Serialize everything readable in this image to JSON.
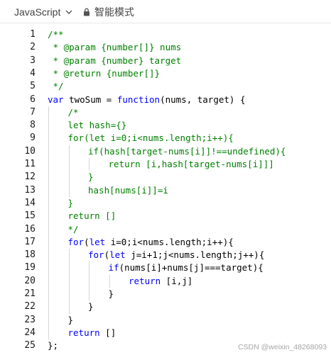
{
  "toolbar": {
    "language": "JavaScript",
    "language_icon": "chevron-down-icon",
    "mode_label": "智能模式",
    "mode_icon": "lock-icon"
  },
  "editor": {
    "lines": [
      {
        "n": "1",
        "indent": 0,
        "tokens": [
          {
            "t": "/**",
            "c": "comment"
          }
        ]
      },
      {
        "n": "2",
        "indent": 0,
        "tokens": [
          {
            "t": " * @param {number[]} nums",
            "c": "comment"
          }
        ]
      },
      {
        "n": "3",
        "indent": 0,
        "tokens": [
          {
            "t": " * @param {number} target",
            "c": "comment"
          }
        ]
      },
      {
        "n": "4",
        "indent": 0,
        "tokens": [
          {
            "t": " * @return {number[]}",
            "c": "comment"
          }
        ]
      },
      {
        "n": "5",
        "indent": 0,
        "tokens": [
          {
            "t": " */",
            "c": "comment"
          }
        ]
      },
      {
        "n": "6",
        "indent": 0,
        "tokens": [
          {
            "t": "var",
            "c": "kw"
          },
          {
            "t": " twoSum = ",
            "c": "plain"
          },
          {
            "t": "function",
            "c": "kw"
          },
          {
            "t": "(nums, target) {",
            "c": "plain"
          }
        ]
      },
      {
        "n": "7",
        "indent": 1,
        "tokens": [
          {
            "t": "/*",
            "c": "comment"
          }
        ]
      },
      {
        "n": "8",
        "indent": 1,
        "tokens": [
          {
            "t": "let hash={}",
            "c": "comment"
          }
        ]
      },
      {
        "n": "9",
        "indent": 1,
        "tokens": [
          {
            "t": "for(let i=0;i<nums.length;i++){",
            "c": "comment"
          }
        ]
      },
      {
        "n": "10",
        "indent": 2,
        "tokens": [
          {
            "t": "if(hash[target-nums[i]]!==undefined){",
            "c": "comment"
          }
        ]
      },
      {
        "n": "11",
        "indent": 3,
        "tokens": [
          {
            "t": "return [i,hash[target-nums[i]]]",
            "c": "comment"
          }
        ]
      },
      {
        "n": "12",
        "indent": 2,
        "tokens": [
          {
            "t": "}",
            "c": "comment"
          }
        ]
      },
      {
        "n": "13",
        "indent": 2,
        "tokens": [
          {
            "t": "hash[nums[i]]=i",
            "c": "comment"
          }
        ]
      },
      {
        "n": "14",
        "indent": 1,
        "tokens": [
          {
            "t": "}",
            "c": "comment"
          }
        ]
      },
      {
        "n": "15",
        "indent": 1,
        "tokens": [
          {
            "t": "return []",
            "c": "comment"
          }
        ]
      },
      {
        "n": "16",
        "indent": 1,
        "tokens": [
          {
            "t": "*/",
            "c": "comment"
          }
        ]
      },
      {
        "n": "17",
        "indent": 1,
        "tokens": [
          {
            "t": "for",
            "c": "kw"
          },
          {
            "t": "(",
            "c": "plain"
          },
          {
            "t": "let",
            "c": "kw"
          },
          {
            "t": " i=0;i<nums.length;i++){",
            "c": "plain"
          }
        ]
      },
      {
        "n": "18",
        "indent": 2,
        "tokens": [
          {
            "t": "for",
            "c": "kw"
          },
          {
            "t": "(",
            "c": "plain"
          },
          {
            "t": "let",
            "c": "kw"
          },
          {
            "t": " j=i+1;j<nums.length;j++){",
            "c": "plain"
          }
        ]
      },
      {
        "n": "19",
        "indent": 3,
        "tokens": [
          {
            "t": "if",
            "c": "kw"
          },
          {
            "t": "(nums[i]+nums[j]===target){",
            "c": "plain"
          }
        ]
      },
      {
        "n": "20",
        "indent": 4,
        "tokens": [
          {
            "t": "return",
            "c": "kw"
          },
          {
            "t": " [i,j]",
            "c": "plain"
          }
        ]
      },
      {
        "n": "21",
        "indent": 3,
        "tokens": [
          {
            "t": "}",
            "c": "plain"
          }
        ]
      },
      {
        "n": "22",
        "indent": 2,
        "tokens": [
          {
            "t": "}",
            "c": "plain"
          }
        ]
      },
      {
        "n": "23",
        "indent": 1,
        "tokens": [
          {
            "t": "}",
            "c": "plain"
          }
        ]
      },
      {
        "n": "24",
        "indent": 1,
        "tokens": [
          {
            "t": "return",
            "c": "kw"
          },
          {
            "t": " []",
            "c": "plain"
          }
        ]
      },
      {
        "n": "25",
        "indent": 0,
        "tokens": [
          {
            "t": "};",
            "c": "plain"
          }
        ]
      }
    ]
  },
  "watermark": "CSDN @weixin_48268093",
  "colors": {
    "comment": "#008000",
    "keyword": "#0000ff",
    "plain": "#000000",
    "line_number": "#1a1a1a",
    "toolbar_text": "#444444"
  }
}
